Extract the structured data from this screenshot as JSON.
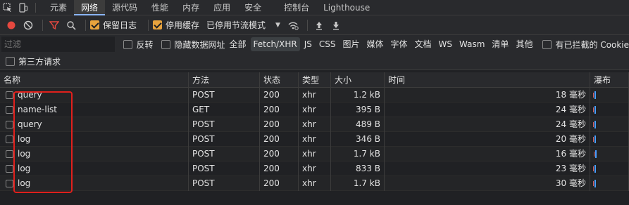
{
  "tabbar": {
    "tabs": [
      {
        "label": "元素"
      },
      {
        "label": "网络"
      },
      {
        "label": "源代码"
      },
      {
        "label": "性能"
      },
      {
        "label": "内存"
      },
      {
        "label": "应用"
      },
      {
        "label": "安全"
      },
      {
        "label": "控制台"
      },
      {
        "label": "Lighthouse"
      }
    ],
    "active_tab": "网络"
  },
  "toolbar": {
    "preserve_log_label": "保留日志",
    "disable_cache_label": "停用缓存",
    "throttle_value": "已停用节流模式",
    "colors": {
      "record": "#e5483f",
      "filter_active": "#e5483f",
      "checkbox": "#e8a33d"
    }
  },
  "filterbar": {
    "filter_placeholder": "过滤",
    "invert_label": "反转",
    "hide_data_urls_label": "隐藏数据网址",
    "types": [
      "全部",
      "Fetch/XHR",
      "JS",
      "CSS",
      "图片",
      "媒体",
      "字体",
      "文档",
      "WS",
      "Wasm",
      "清单",
      "其他"
    ],
    "active_type": "Fetch/XHR",
    "blocked_cookies_label": "有已拦截的 Cookie"
  },
  "thirdparty_label": "第三方请求",
  "table": {
    "headers": {
      "name": "名称",
      "method": "方法",
      "status": "状态",
      "type": "类型",
      "size": "大小",
      "time": "时间",
      "waterfall": "瀑布"
    },
    "rows": [
      {
        "name": "query",
        "method": "POST",
        "status": "200",
        "type": "xhr",
        "size": "1.2 kB",
        "time": "18 毫秒"
      },
      {
        "name": "name-list",
        "method": "GET",
        "status": "200",
        "type": "xhr",
        "size": "395 B",
        "time": "24 毫秒"
      },
      {
        "name": "query",
        "method": "POST",
        "status": "200",
        "type": "xhr",
        "size": "489 B",
        "time": "24 毫秒"
      },
      {
        "name": "log",
        "method": "POST",
        "status": "200",
        "type": "xhr",
        "size": "346 B",
        "time": "20 毫秒"
      },
      {
        "name": "log",
        "method": "POST",
        "status": "200",
        "type": "xhr",
        "size": "1.7 kB",
        "time": "16 毫秒"
      },
      {
        "name": "log",
        "method": "POST",
        "status": "200",
        "type": "xhr",
        "size": "833 B",
        "time": "23 毫秒"
      },
      {
        "name": "log",
        "method": "POST",
        "status": "200",
        "type": "xhr",
        "size": "1.7 kB",
        "time": "30 毫秒"
      }
    ]
  },
  "annotation": {
    "highlight_color": "#e0201c"
  }
}
